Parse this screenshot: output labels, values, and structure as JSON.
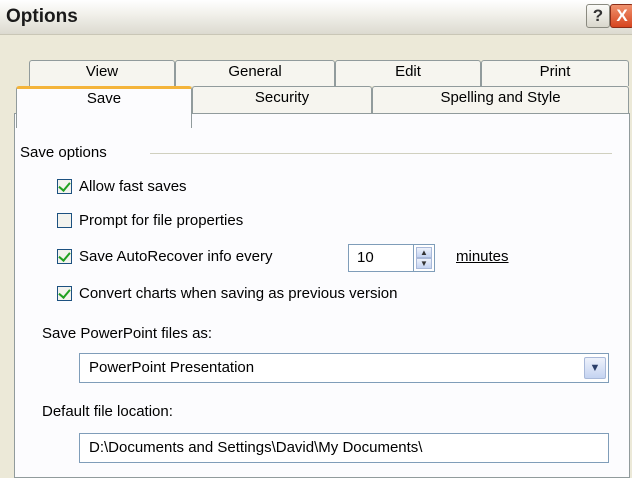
{
  "window": {
    "title": "Options",
    "help_glyph": "?",
    "close_glyph": "X"
  },
  "tabs": {
    "row1": [
      {
        "label": "View"
      },
      {
        "label": "General"
      },
      {
        "label": "Edit"
      },
      {
        "label": "Print"
      }
    ],
    "row2": [
      {
        "label": "Save",
        "active": true
      },
      {
        "label": "Security"
      },
      {
        "label": "Spelling and Style"
      }
    ]
  },
  "save_options": {
    "group_label": "Save options",
    "allow_fast_saves": {
      "label": "Allow fast saves",
      "checked": true
    },
    "prompt_props": {
      "label": "Prompt for file properties",
      "checked": false
    },
    "autorecover": {
      "label": "Save AutoRecover info every",
      "checked": true,
      "value": "10",
      "unit": "minutes"
    },
    "convert_charts": {
      "label": "Convert charts when saving as previous version",
      "checked": true
    }
  },
  "save_as": {
    "label": "Save PowerPoint files as:",
    "selected": "PowerPoint Presentation"
  },
  "default_location": {
    "label": "Default file location:",
    "value": "D:\\Documents and Settings\\David\\My Documents\\"
  },
  "colors": {
    "tab_accent": "#f4b43a",
    "check": "#21a121",
    "field_border": "#7f9db9"
  }
}
